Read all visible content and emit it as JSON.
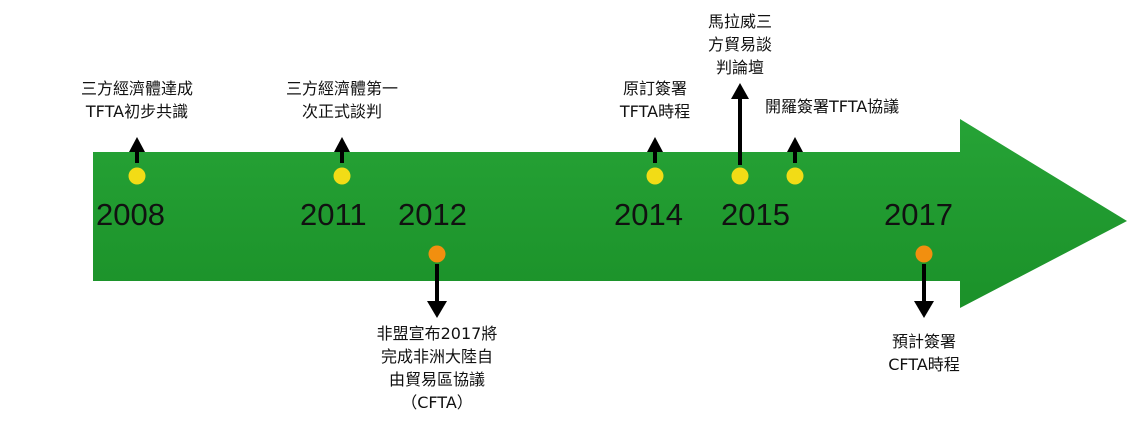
{
  "colors": {
    "arrow": "#1f9a2f",
    "event_above": "#f2dc16",
    "event_below": "#f28f0f",
    "pointer": "#000000"
  },
  "years": [
    "2008",
    "2011",
    "2012",
    "2014",
    "2015",
    "2017"
  ],
  "events": {
    "tfta_consensus": [
      "三方經濟體達成",
      "TFTA初步共識"
    ],
    "tfta_first_negotiation": [
      "三方經濟體第一",
      "次正式談判"
    ],
    "au_cfta_announcement": [
      "非盟宣布2017將",
      "完成非洲大陸自",
      "由貿易區協議",
      "（CFTA）"
    ],
    "tfta_signing_schedule": [
      "原訂簽署",
      "TFTA時程"
    ],
    "malawi_forum": [
      "馬拉威三",
      "方貿易談",
      "判論壇"
    ],
    "cairo_signing": [
      "開羅簽署TFTA協議"
    ],
    "cfta_signing_schedule": [
      "預計簽署",
      "CFTA時程"
    ]
  }
}
